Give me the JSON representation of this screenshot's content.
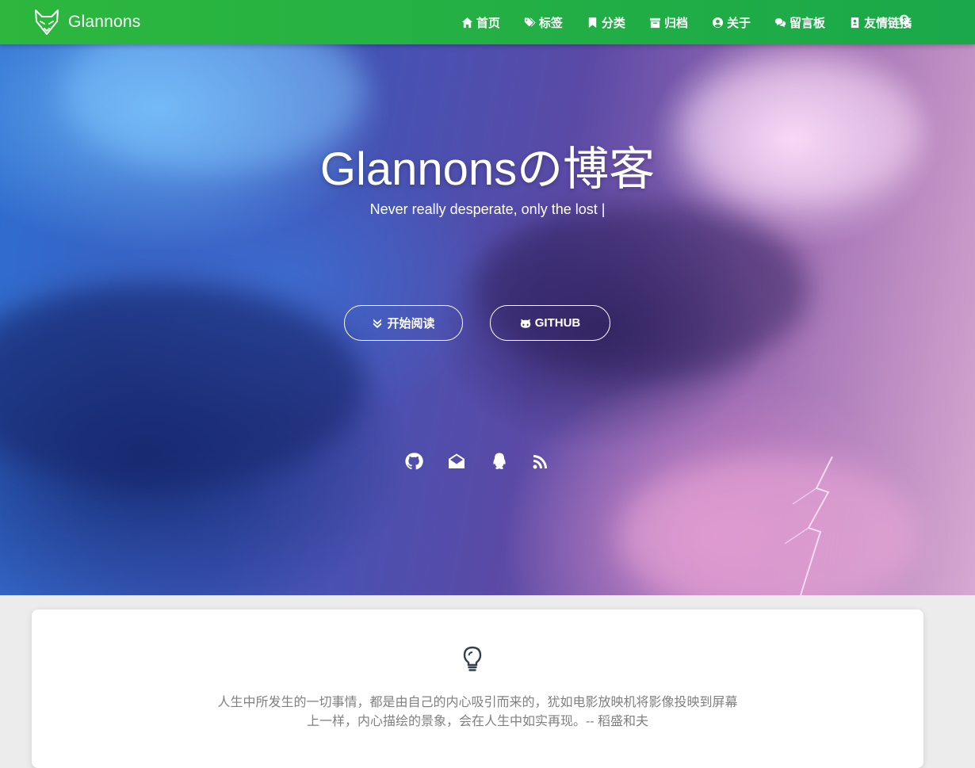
{
  "brand": {
    "name": "Glannons",
    "logo_icon": "fox-logo-icon"
  },
  "nav": {
    "items": [
      {
        "label": "首页",
        "icon": "home-icon"
      },
      {
        "label": "标签",
        "icon": "tags-icon"
      },
      {
        "label": "分类",
        "icon": "bookmark-icon"
      },
      {
        "label": "归档",
        "icon": "archive-icon"
      },
      {
        "label": "关于",
        "icon": "user-circle-icon"
      },
      {
        "label": "留言板",
        "icon": "comments-icon"
      },
      {
        "label": "友情链接",
        "icon": "address-book-icon"
      }
    ],
    "search_icon": "search-icon"
  },
  "hero": {
    "title": "Glannonsの博客",
    "subtitle": "Never really desperate, only the lost |",
    "buttons": {
      "read": "开始阅读",
      "github": "GITHUB"
    },
    "social_icons": [
      "github-icon",
      "envelope-open-icon",
      "qq-icon",
      "rss-icon"
    ]
  },
  "quote": {
    "icon": "lightbulb-icon",
    "text": "人生中所发生的一切事情，都是由自己的内心吸引而来的，犹如电影放映机将影像投映到屏幕上一样，内心描绘的景象，会在人生中如实再现。-- 稻盛和夫"
  },
  "colors": {
    "nav_green": "#2db73e",
    "quote_text": "#808080",
    "card_bg": "#ffffff"
  }
}
